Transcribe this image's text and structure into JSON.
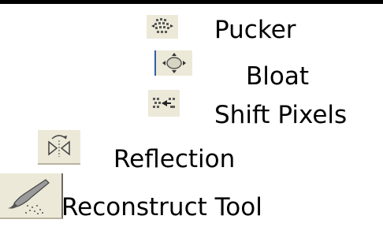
{
  "tools": [
    {
      "id": "pucker",
      "label": "Pucker",
      "icon": "pucker-icon"
    },
    {
      "id": "bloat",
      "label": "Bloat",
      "icon": "bloat-icon"
    },
    {
      "id": "shift_pixels",
      "label": "Shift Pixels",
      "icon": "shift-pixels-icon"
    },
    {
      "id": "reflection",
      "label": "Reflection",
      "icon": "reflection-icon"
    },
    {
      "id": "reconstruct",
      "label": "Reconstruct Tool",
      "icon": "reconstruct-icon"
    }
  ],
  "colors": {
    "background": "#ffffff",
    "top_border": "#000000",
    "icon_face": "#ece9d8",
    "icon_glyph": "#5a5a5a"
  }
}
